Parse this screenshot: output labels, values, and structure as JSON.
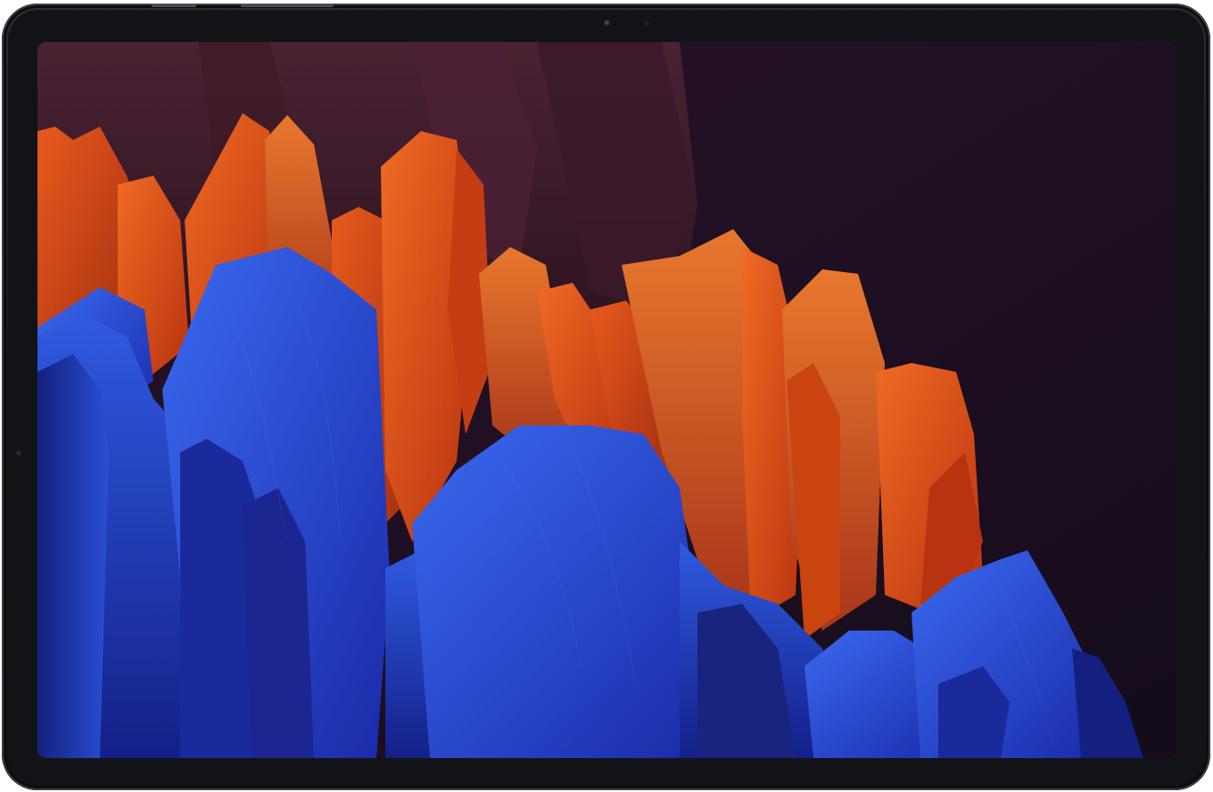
{
  "device": {
    "type": "tablet",
    "frame_color": "#16181b",
    "orientation": "landscape"
  },
  "wallpaper": {
    "description_colors": {
      "background": "#1c1020",
      "dark_fins": "#3b1a26",
      "orange": "#e2561b",
      "orange_light": "#f0702a",
      "blue": "#2a52d6",
      "blue_dark": "#14207a"
    }
  },
  "icons": {
    "front_camera": "camera-icon",
    "sensor": "sensor-icon"
  }
}
